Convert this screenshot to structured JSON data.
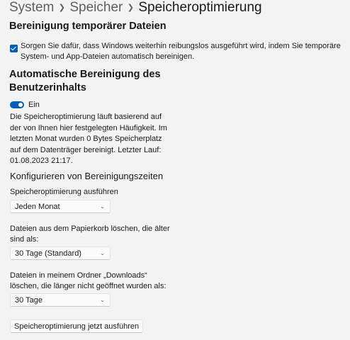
{
  "breadcrumb": {
    "items": [
      "System",
      "Speicher"
    ],
    "current": "Speicheroptimierung",
    "separator_icon": "chevron-right-icon"
  },
  "temp_files": {
    "title": "Bereinigung temporärer Dateien",
    "checkbox_label": "Sorgen Sie dafür, dass Windows weiterhin reibungslos ausgeführt wird, indem Sie temporäre System- und App-Dateien automatisch bereinigen.",
    "checked": true
  },
  "auto_cleanup": {
    "title_line1": "Automatische Bereinigung des",
    "title_line2": "Benutzerinhalts",
    "toggle_label": "Ein",
    "toggle_on": true,
    "description": "Die Speicheroptimierung läuft basierend auf der von Ihnen hier festgelegten Häufigkeit. Im letzten Monat wurden 0 Bytes Speicherplatz auf dem Datenträger bereinigt. Letzter Lauf: 01.08.2023 21:17."
  },
  "schedule": {
    "heading": "Konfigurieren von Bereinigungszeiten",
    "run_label": "Speicheroptimierung ausführen",
    "run_value": "Jeden Monat",
    "recycle_label": "Dateien aus dem Papierkorb löschen, die älter sind als:",
    "recycle_value": "30 Tage (Standard)",
    "downloads_label": "Dateien in meinem Ordner „Downloads“ löschen, die länger nicht geöffnet wurden als:",
    "downloads_value": "30 Tage",
    "dropdown_icon": "chevron-down-icon"
  },
  "actions": {
    "run_now": "Speicheroptimierung jetzt ausführen"
  },
  "colors": {
    "accent": "#005fb8",
    "background": "#f3f3f3"
  }
}
